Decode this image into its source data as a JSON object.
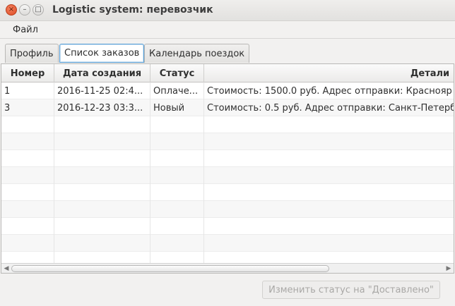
{
  "window": {
    "title": "Logistic system: перевозчик",
    "close_glyph": "×",
    "minimize_glyph": "–",
    "maximize_glyph": "□"
  },
  "menu": {
    "file_label": "Файл"
  },
  "tabs": [
    {
      "label": "Профиль",
      "active": false
    },
    {
      "label": "Список заказов",
      "active": true
    },
    {
      "label": "Календарь поездок",
      "active": false
    }
  ],
  "table": {
    "columns": [
      "Номер",
      "Дата создания",
      "Статус",
      "Детали"
    ],
    "rows": [
      [
        "1",
        "2016-11-25 02:4...",
        "Оплаче...",
        "Стоимость: 1500.0 руб. Адрес отправки: Краснояр"
      ],
      [
        "3",
        "2016-12-23 03:3...",
        "Новый",
        "Стоимость: 0.5 руб. Адрес отправки: Санкт-Петерб"
      ]
    ]
  },
  "scrollbar": {
    "left_arrow": "◀",
    "right_arrow": "▶"
  },
  "action_button": {
    "label": "Изменить статус на \"Доставлено\"",
    "enabled": false
  }
}
